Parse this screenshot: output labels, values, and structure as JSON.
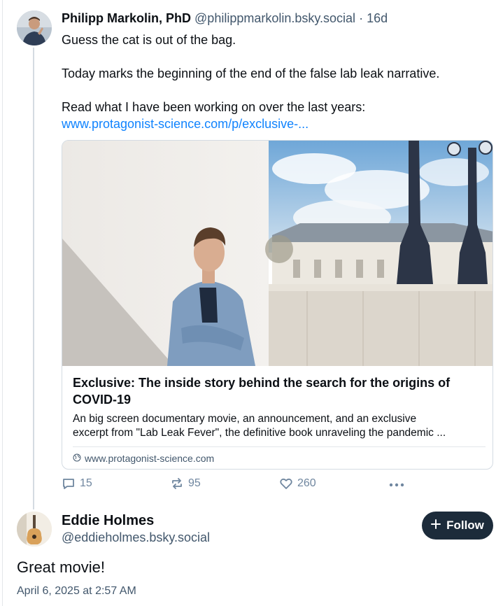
{
  "parent_post": {
    "author_name": "Philipp Markolin, PhD",
    "author_handle": "@philippmarkolin.bsky.social",
    "separator": "·",
    "age": "16d",
    "text_line_1": "Guess the cat is out of the bag.",
    "text_line_2": "Today marks the beginning of the end of the false lab leak narrative.",
    "text_line_3": "Read what I have been working on over the last years:",
    "link_text": "www.protagonist-science.com/p/exclusive-...",
    "embed": {
      "title": "Exclusive: The inside story behind the search for the origins of COVID-19",
      "description_line_1": "An big screen documentary movie, an announcement, and an exclusive",
      "description_line_2": "excerpt from \"Lab Leak Fever\", the definitive book unraveling the pandemic ...",
      "domain": "www.protagonist-science.com"
    },
    "actions": {
      "replies": "15",
      "reposts": "95",
      "likes": "260"
    }
  },
  "reply_post": {
    "author_name": "Eddie Holmes",
    "author_handle": "@eddieholmes.bsky.social",
    "follow_label": "Follow",
    "text": "Great movie!",
    "timestamp": "April 6, 2025 at 2:57 AM"
  },
  "icons": {
    "reply": "reply-bubble-icon",
    "repost": "repost-icon",
    "like": "heart-icon",
    "more": "ellipsis-icon",
    "follow": "plus-icon",
    "domain": "globe-icon"
  },
  "colors": {
    "link": "#1083fe",
    "muted": "#42576c",
    "action": "#6f869f",
    "follow_bg": "#1c2b3a"
  }
}
